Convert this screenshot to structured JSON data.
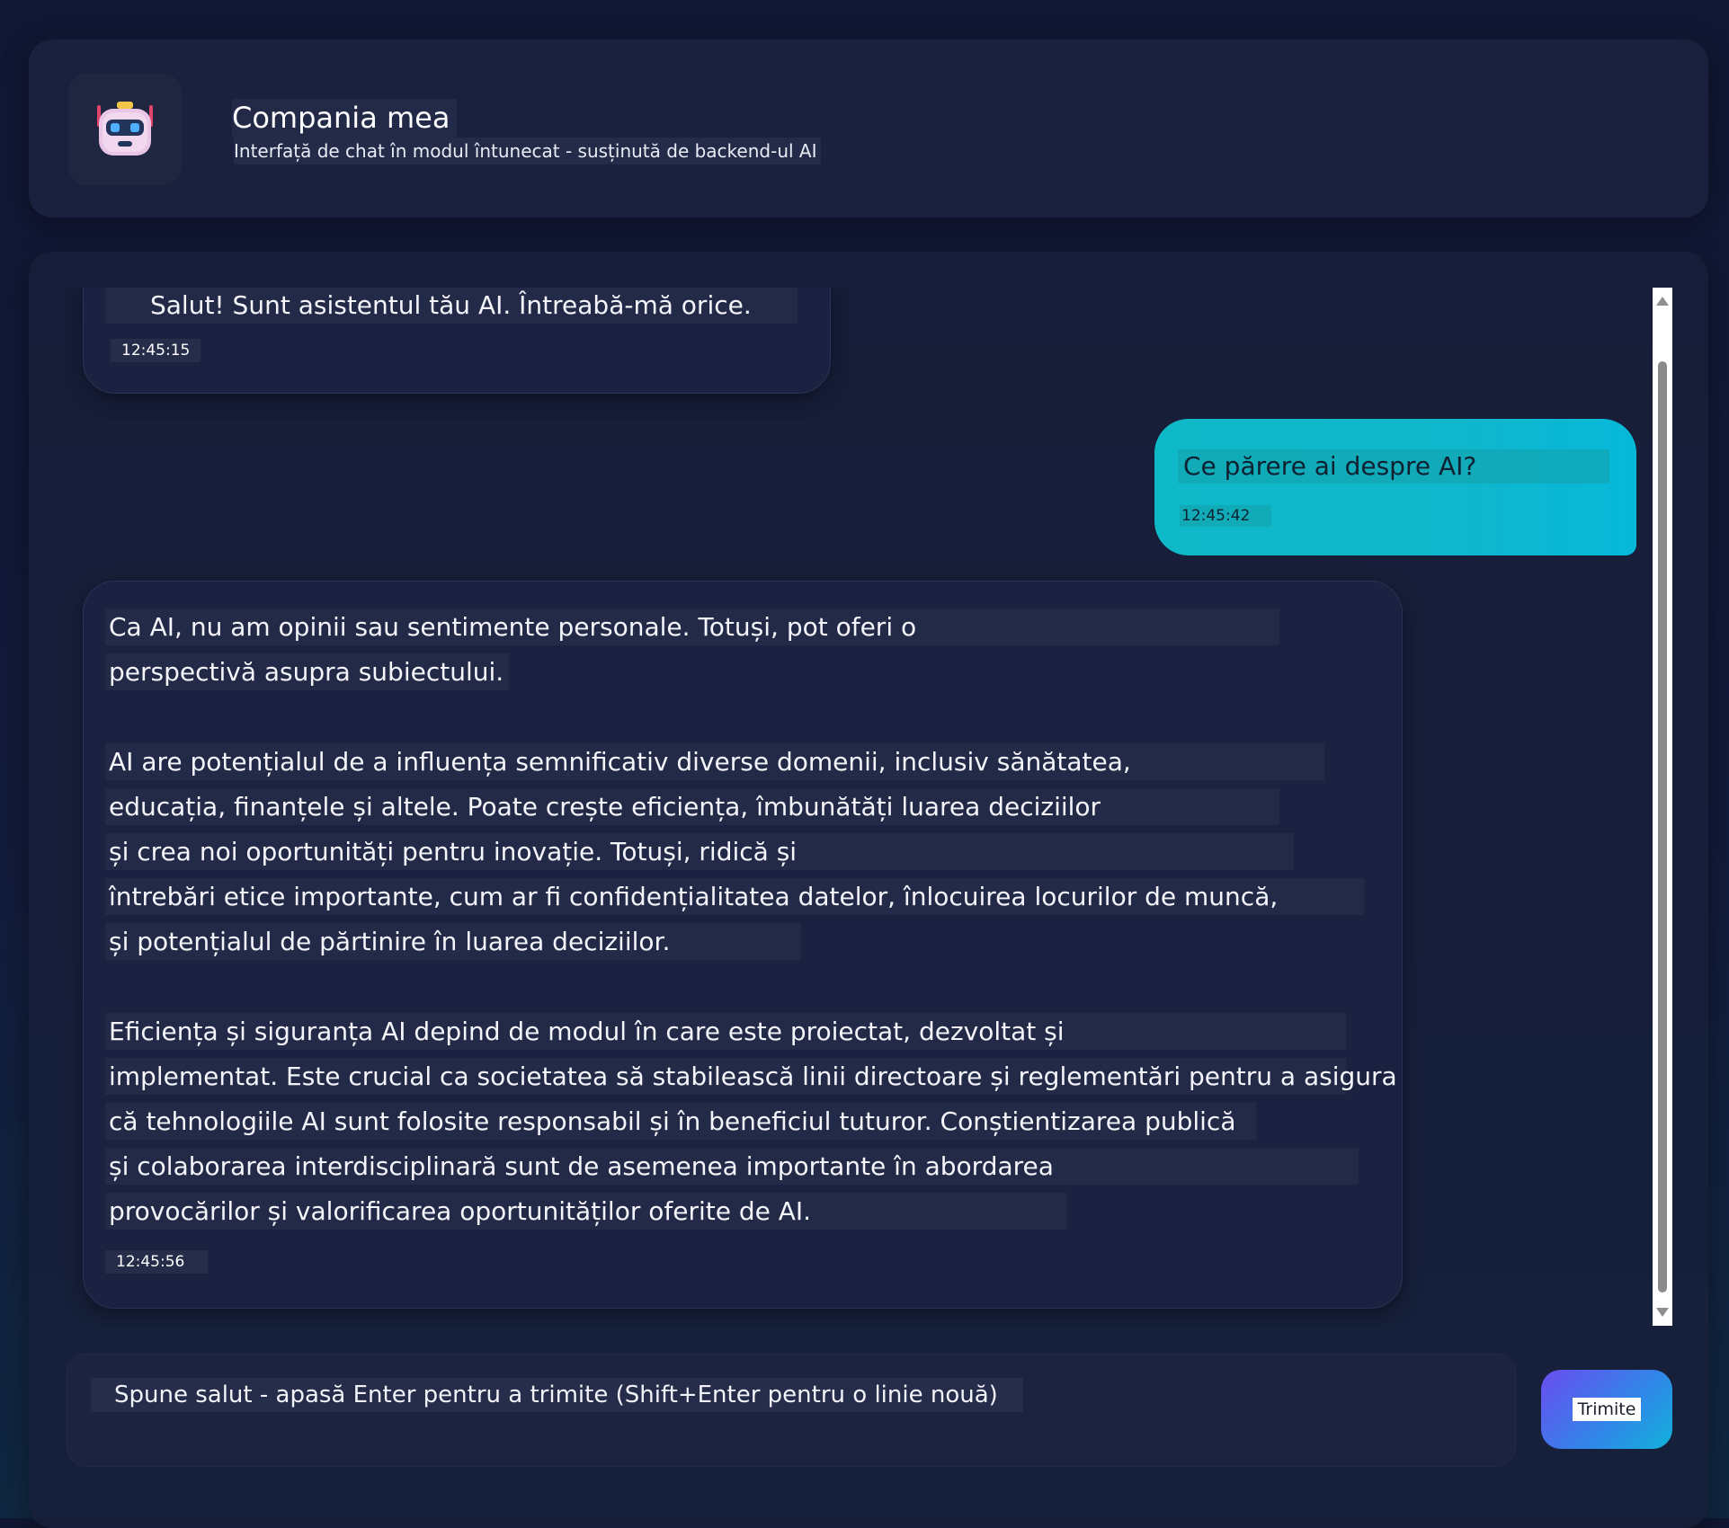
{
  "header": {
    "title": "Compania mea",
    "subtitle": "Interfață de chat în modul întunecat - susținută de backend-ul AI",
    "avatar_icon": "robot-icon"
  },
  "messages": [
    {
      "role": "assistant",
      "lines": [
        "Salut! Sunt asistentul tău AI. Întreabă-mă orice."
      ],
      "time": "12:45:15"
    },
    {
      "role": "user",
      "lines": [
        "Ce părere ai despre AI?"
      ],
      "time": "12:45:42"
    },
    {
      "role": "assistant",
      "lines": [
        "Ca AI, nu am opinii sau sentimente personale. Totuși, pot oferi o",
        "perspectivă asupra subiectului.",
        "AI are potențialul de a influența semnificativ diverse domenii, inclusiv sănătatea,",
        "educația, finanțele și altele. Poate crește eficiența, îmbunătăți luarea deciziilor",
        "și crea noi oportunități pentru inovație. Totuși, ridică și",
        "întrebări etice importante, cum ar fi confidențialitatea datelor, înlocuirea locurilor de muncă,",
        "și potențialul de părtinire în luarea deciziilor.",
        "Eficiența și siguranța AI depind de modul în care este proiectat, dezvoltat și",
        "implementat. Este crucial ca societatea să stabilească linii directoare și reglementări pentru a asigura",
        "că tehnologiile AI sunt folosite responsabil și în beneficiul tuturor. Conștientizarea publică",
        "și colaborarea interdisciplinară sunt de asemenea importante în abordarea",
        "provocărilor și valorificarea oportunităților oferite de AI."
      ],
      "time": "12:45:56"
    }
  ],
  "composer": {
    "placeholder": "Spune salut - apasă Enter pentru a trimite (Shift+Enter pentru o linie nouă)",
    "send_label": "Trimite"
  },
  "colors": {
    "user_bubble": "#10b6cb",
    "send_gradient_start": "#6b4cf0",
    "send_gradient_end": "#12b2da"
  }
}
